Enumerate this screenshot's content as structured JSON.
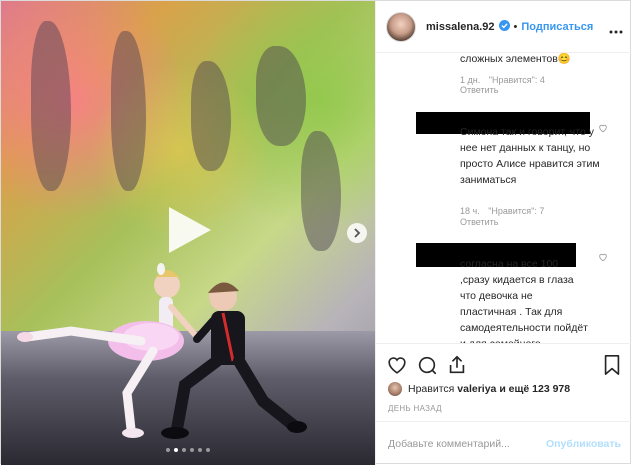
{
  "header": {
    "username": "missalena.92",
    "separator": "•",
    "follow_label": "Подписаться"
  },
  "comments": [
    {
      "text": "сложных элементов😊",
      "time": "1 дн.",
      "likes": "\"Нравится\": 4",
      "reply": "Ответить"
    },
    {
      "text": "Симона так и говорит, что у нее нет данных к танцу, но просто Алисе нравится этим заниматься",
      "time": "18 ч.",
      "likes": "\"Нравится\": 7",
      "reply": "Ответить"
    },
    {
      "text": "согласна на все 100 ,сразу кидается в глаза что девочка не пластичная . Так для самодеятельности пойдёт и для семейного"
    }
  ],
  "likes": {
    "prefix": "Нравится",
    "user": "valeriya",
    "suffix": "и ещё 123 978"
  },
  "timestamp": "ДЕНЬ НАЗАД",
  "add_comment": {
    "placeholder": "Добавьте комментарий...",
    "publish_label": "Опубликовать"
  },
  "media": {
    "type": "video",
    "carousel_dots": 6,
    "active_dot": 1
  },
  "colors": {
    "accent": "#3897f0",
    "publish_disabled": "#b2dffc",
    "meta_text": "#999999"
  }
}
